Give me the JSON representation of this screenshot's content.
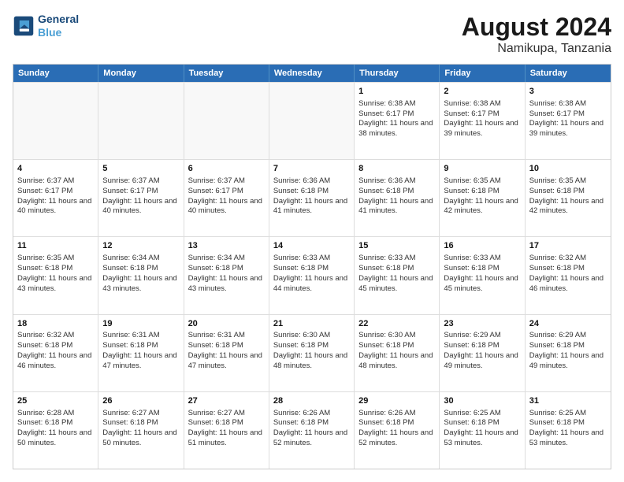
{
  "header": {
    "logo_line1": "General",
    "logo_line2": "Blue",
    "main_title": "August 2024",
    "subtitle": "Namikupa, Tanzania"
  },
  "weekdays": [
    "Sunday",
    "Monday",
    "Tuesday",
    "Wednesday",
    "Thursday",
    "Friday",
    "Saturday"
  ],
  "rows": [
    [
      {
        "empty": true
      },
      {
        "empty": true
      },
      {
        "empty": true
      },
      {
        "empty": true
      },
      {
        "day": 1,
        "sunrise": "6:38 AM",
        "sunset": "6:17 PM",
        "hours": "11 hours and 38 minutes."
      },
      {
        "day": 2,
        "sunrise": "6:38 AM",
        "sunset": "6:17 PM",
        "hours": "11 hours and 39 minutes."
      },
      {
        "day": 3,
        "sunrise": "6:38 AM",
        "sunset": "6:17 PM",
        "hours": "11 hours and 39 minutes."
      }
    ],
    [
      {
        "day": 4,
        "sunrise": "6:37 AM",
        "sunset": "6:17 PM",
        "hours": "11 hours and 40 minutes."
      },
      {
        "day": 5,
        "sunrise": "6:37 AM",
        "sunset": "6:17 PM",
        "hours": "11 hours and 40 minutes."
      },
      {
        "day": 6,
        "sunrise": "6:37 AM",
        "sunset": "6:17 PM",
        "hours": "11 hours and 40 minutes."
      },
      {
        "day": 7,
        "sunrise": "6:36 AM",
        "sunset": "6:18 PM",
        "hours": "11 hours and 41 minutes."
      },
      {
        "day": 8,
        "sunrise": "6:36 AM",
        "sunset": "6:18 PM",
        "hours": "11 hours and 41 minutes."
      },
      {
        "day": 9,
        "sunrise": "6:35 AM",
        "sunset": "6:18 PM",
        "hours": "11 hours and 42 minutes."
      },
      {
        "day": 10,
        "sunrise": "6:35 AM",
        "sunset": "6:18 PM",
        "hours": "11 hours and 42 minutes."
      }
    ],
    [
      {
        "day": 11,
        "sunrise": "6:35 AM",
        "sunset": "6:18 PM",
        "hours": "11 hours and 43 minutes."
      },
      {
        "day": 12,
        "sunrise": "6:34 AM",
        "sunset": "6:18 PM",
        "hours": "11 hours and 43 minutes."
      },
      {
        "day": 13,
        "sunrise": "6:34 AM",
        "sunset": "6:18 PM",
        "hours": "11 hours and 43 minutes."
      },
      {
        "day": 14,
        "sunrise": "6:33 AM",
        "sunset": "6:18 PM",
        "hours": "11 hours and 44 minutes."
      },
      {
        "day": 15,
        "sunrise": "6:33 AM",
        "sunset": "6:18 PM",
        "hours": "11 hours and 45 minutes."
      },
      {
        "day": 16,
        "sunrise": "6:33 AM",
        "sunset": "6:18 PM",
        "hours": "11 hours and 45 minutes."
      },
      {
        "day": 17,
        "sunrise": "6:32 AM",
        "sunset": "6:18 PM",
        "hours": "11 hours and 46 minutes."
      }
    ],
    [
      {
        "day": 18,
        "sunrise": "6:32 AM",
        "sunset": "6:18 PM",
        "hours": "11 hours and 46 minutes."
      },
      {
        "day": 19,
        "sunrise": "6:31 AM",
        "sunset": "6:18 PM",
        "hours": "11 hours and 47 minutes."
      },
      {
        "day": 20,
        "sunrise": "6:31 AM",
        "sunset": "6:18 PM",
        "hours": "11 hours and 47 minutes."
      },
      {
        "day": 21,
        "sunrise": "6:30 AM",
        "sunset": "6:18 PM",
        "hours": "11 hours and 48 minutes."
      },
      {
        "day": 22,
        "sunrise": "6:30 AM",
        "sunset": "6:18 PM",
        "hours": "11 hours and 48 minutes."
      },
      {
        "day": 23,
        "sunrise": "6:29 AM",
        "sunset": "6:18 PM",
        "hours": "11 hours and 49 minutes."
      },
      {
        "day": 24,
        "sunrise": "6:29 AM",
        "sunset": "6:18 PM",
        "hours": "11 hours and 49 minutes."
      }
    ],
    [
      {
        "day": 25,
        "sunrise": "6:28 AM",
        "sunset": "6:18 PM",
        "hours": "11 hours and 50 minutes."
      },
      {
        "day": 26,
        "sunrise": "6:27 AM",
        "sunset": "6:18 PM",
        "hours": "11 hours and 50 minutes."
      },
      {
        "day": 27,
        "sunrise": "6:27 AM",
        "sunset": "6:18 PM",
        "hours": "11 hours and 51 minutes."
      },
      {
        "day": 28,
        "sunrise": "6:26 AM",
        "sunset": "6:18 PM",
        "hours": "11 hours and 52 minutes."
      },
      {
        "day": 29,
        "sunrise": "6:26 AM",
        "sunset": "6:18 PM",
        "hours": "11 hours and 52 minutes."
      },
      {
        "day": 30,
        "sunrise": "6:25 AM",
        "sunset": "6:18 PM",
        "hours": "11 hours and 53 minutes."
      },
      {
        "day": 31,
        "sunrise": "6:25 AM",
        "sunset": "6:18 PM",
        "hours": "11 hours and 53 minutes."
      }
    ]
  ]
}
